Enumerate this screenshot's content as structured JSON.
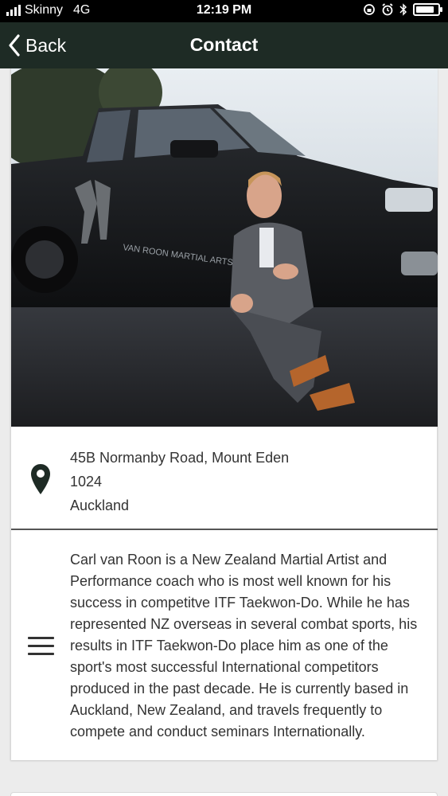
{
  "status_bar": {
    "carrier": "Skinny",
    "network": "4G",
    "time": "12:19 PM",
    "battery_level": 0.85
  },
  "nav": {
    "back_label": "Back",
    "title": "Contact"
  },
  "hero_image": {
    "truck_lettering": "VAN ROON MARTIAL ARTS"
  },
  "address": {
    "line1": "45B Normanby Road, Mount Eden",
    "line2": "1024",
    "line3": "Auckland"
  },
  "description": {
    "text": "Carl van Roon is a New Zealand Martial Artist and Performance coach who is most well known for his success in competitve ITF Taekwon-Do. While he has represented NZ overseas in several combat sports, his results in ITF Taekwon-Do place him as one of the sport's most successful International competitors produced in the past decade. He is currently based in Auckland, New Zealand, and travels frequently to compete and conduct seminars Internationally."
  },
  "colors": {
    "nav_background": "#1e2b25",
    "status_background": "#000000",
    "page_background": "#ececec"
  },
  "icons": [
    "signal-icon",
    "back-chevron-icon",
    "location-pin-icon",
    "menu-lines-icon",
    "alarm-icon",
    "bluetooth-icon",
    "battery-icon"
  ]
}
